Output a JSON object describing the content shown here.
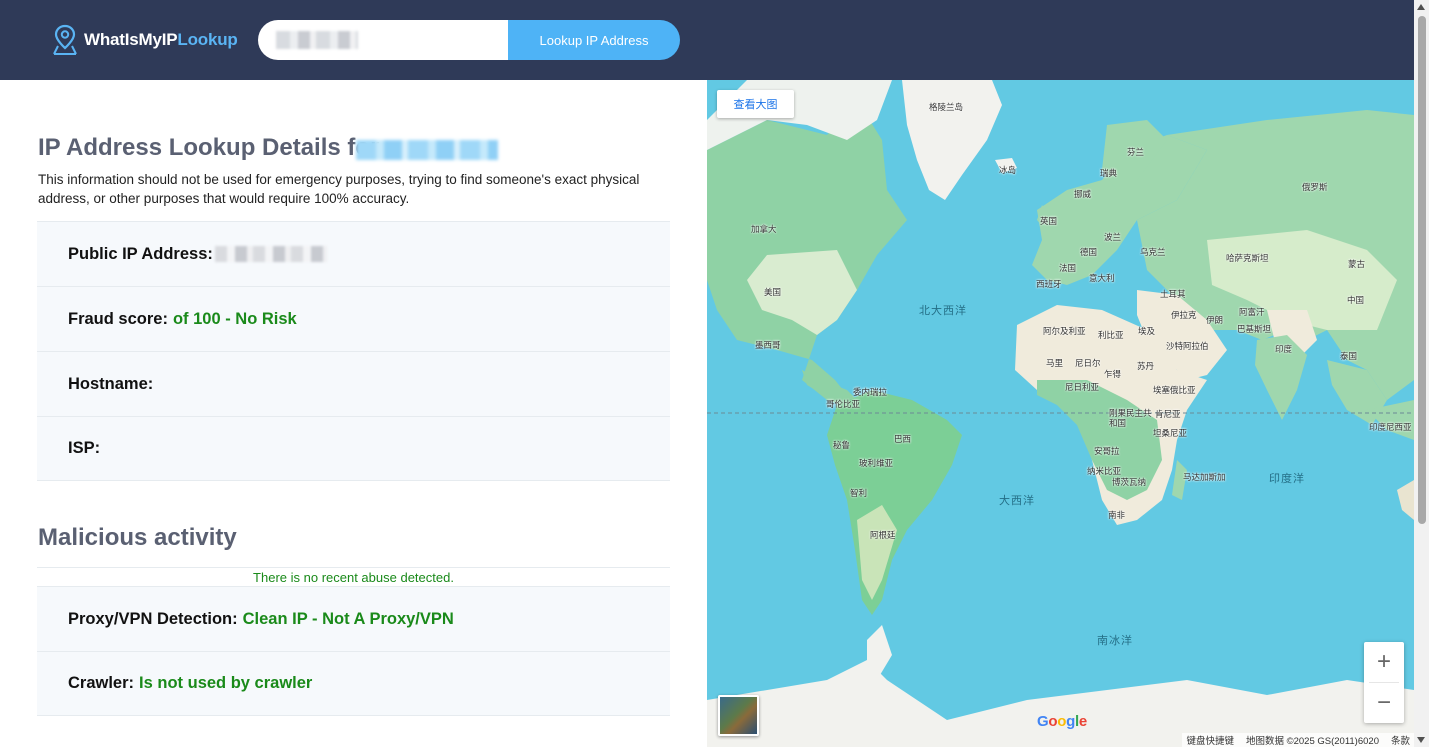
{
  "brand": {
    "name_main": "WhatIsMyIP",
    "name_accent": "Lookup",
    "accent_color": "#5ab4f4",
    "header_bg": "#2f3a58"
  },
  "search": {
    "value": "",
    "button_label": "Lookup IP Address",
    "button_color": "#4eb3f6"
  },
  "details": {
    "title": "IP Address Lookup Details for",
    "description": "This information should not be used for emergency purposes, trying to find someone's exact physical address, or other purposes that would require 100% accuracy.",
    "rows": [
      {
        "label": "Public IP Address:",
        "value": ""
      },
      {
        "label": "Fraud score:",
        "value": "of 100 - No Risk"
      },
      {
        "label": "Hostname:",
        "value": ""
      },
      {
        "label": "ISP:",
        "value": ""
      }
    ]
  },
  "malicious": {
    "title": "Malicious activity",
    "abuse_text": "There is no recent abuse detected.",
    "rows": [
      {
        "label": "Proxy/VPN Detection:",
        "value": "Clean IP - Not A Proxy/VPN"
      },
      {
        "label": "Crawler:",
        "value": "Is not used by crawler"
      }
    ],
    "good_color": "#1a8a1a"
  },
  "map": {
    "view_large_label": "查看大图",
    "zoom_in": "+",
    "zoom_out": "−",
    "google_logo": "Google",
    "attribution": [
      "键盘快捷键",
      "地图数据 ©2025 GS(2011)6020",
      "条款"
    ],
    "oceans": [
      "北大西洋",
      "大西洋",
      "南冰洋",
      "印度洋"
    ],
    "places": [
      "格陵兰岛",
      "冰岛",
      "芬兰",
      "瑞典",
      "挪威",
      "俄罗斯",
      "英国",
      "加拿大",
      "德国",
      "波兰",
      "乌克兰",
      "法国",
      "西班牙",
      "意大利",
      "哈萨克斯坦",
      "蒙古",
      "美国",
      "土耳其",
      "中国",
      "阿富汗",
      "伊朗",
      "伊拉克",
      "阿尔及利亚",
      "利比亚",
      "埃及",
      "沙特阿拉伯",
      "巴基斯坦",
      "印度",
      "墨西哥",
      "马里",
      "尼日尔",
      "乍得",
      "苏丹",
      "泰国",
      "尼日利亚",
      "埃塞俄比亚",
      "委内瑞拉",
      "哥伦比亚",
      "刚果民主共和国",
      "肯尼亚",
      "坦桑尼亚",
      "印度尼西亚",
      "秘鲁",
      "巴西",
      "安哥拉",
      "玻利维亚",
      "纳米比亚",
      "博茨瓦纳",
      "马达加斯加",
      "智利",
      "南非",
      "阿根廷"
    ]
  }
}
